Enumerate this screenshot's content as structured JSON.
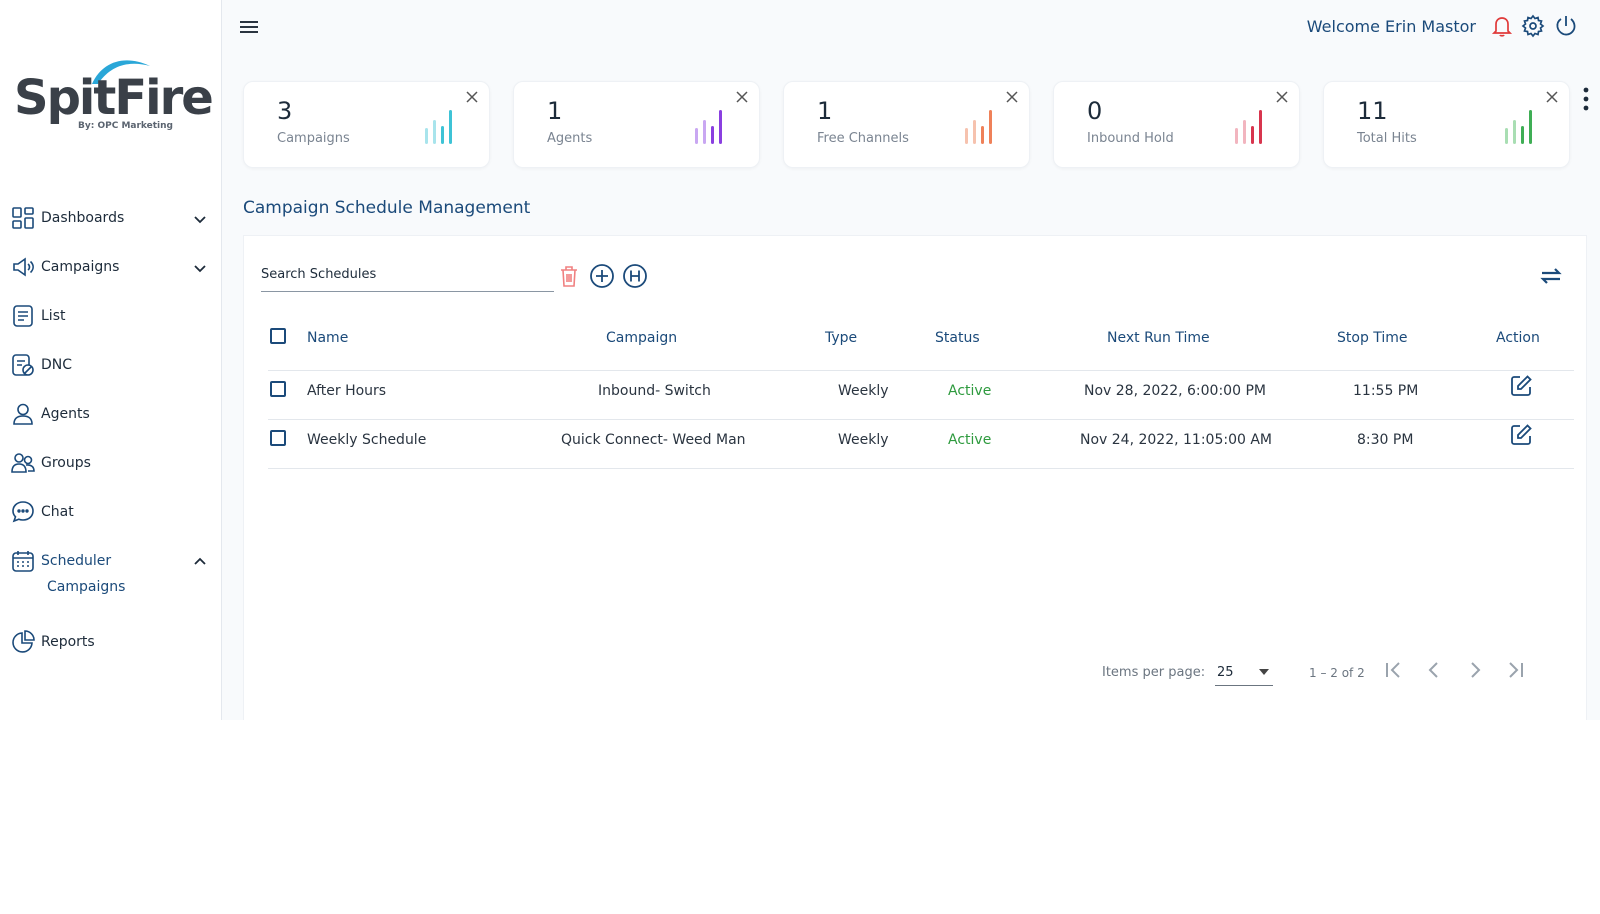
{
  "brand": {
    "logo_text": "SpitFire",
    "logo_subtext": "By: OPC Marketing"
  },
  "sidebar": {
    "items": [
      {
        "label": "Dashboards",
        "icon": "dashboard-grid-icon",
        "expand": "chevron-down"
      },
      {
        "label": "Campaigns",
        "icon": "megaphone-icon",
        "expand": "chevron-down"
      },
      {
        "label": "List",
        "icon": "list-doc-icon"
      },
      {
        "label": "DNC",
        "icon": "dnc-doc-icon"
      },
      {
        "label": "Agents",
        "icon": "user-icon"
      },
      {
        "label": "Groups",
        "icon": "users-icon"
      },
      {
        "label": "Chat",
        "icon": "chat-bubble-icon"
      },
      {
        "label": "Scheduler",
        "icon": "calendar-icon",
        "expand": "chevron-up"
      },
      {
        "label": "Reports",
        "icon": "pie-chart-icon"
      }
    ],
    "scheduler_sub": {
      "label": "Campaigns"
    }
  },
  "header": {
    "welcome": "Welcome Erin Mastor",
    "icons": [
      "menu-icon",
      "bell-icon",
      "gear-icon",
      "power-icon"
    ]
  },
  "stats": [
    {
      "value": "3",
      "label": "Campaigns",
      "color": "#3ec3d6",
      "light": "#a8e4ec"
    },
    {
      "value": "1",
      "label": "Agents",
      "color": "#8a3fe0",
      "light": "#c9a7f2"
    },
    {
      "value": "1",
      "label": "Free Channels",
      "color": "#ef8159",
      "light": "#f6c2ae"
    },
    {
      "value": "0",
      "label": "Inbound Hold",
      "color": "#d8354e",
      "light": "#f2b5bf"
    },
    {
      "value": "11",
      "label": "Total Hits",
      "color": "#3fae55",
      "light": "#a9deb3"
    }
  ],
  "section_title": "Campaign Schedule Management",
  "search": {
    "placeholder": "Search Schedules"
  },
  "table": {
    "columns": [
      "Name",
      "Campaign",
      "Type",
      "Status",
      "Next Run Time",
      "Stop Time",
      "Action"
    ],
    "rows": [
      {
        "name": "After Hours",
        "campaign": "Inbound- Switch",
        "type": "Weekly",
        "status": "Active",
        "next_run": "Nov 28, 2022, 6:00:00 PM",
        "stop_time": "11:55 PM"
      },
      {
        "name": "Weekly Schedule",
        "campaign": "Quick Connect- Weed Man",
        "type": "Weekly",
        "status": "Active",
        "next_run": "Nov 24, 2022, 11:05:00 AM",
        "stop_time": "8:30 PM"
      }
    ]
  },
  "pagination": {
    "items_per_page_label": "Items per page:",
    "items_per_page": "25",
    "range": "1 – 2 of 2"
  },
  "colors": {
    "primary": "#1b4a7a",
    "active": "#2e9a3e",
    "delete": "#f08080"
  }
}
